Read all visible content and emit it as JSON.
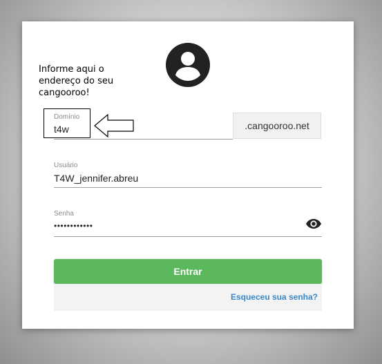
{
  "annotation": {
    "line1": "Informe aqui o",
    "line2": "endereço do seu",
    "line3": "cangooroo!"
  },
  "login": {
    "avatar_icon": "account-circle-icon",
    "domain": {
      "label": "Domínio",
      "value": "t4w",
      "suffix": ".cangooroo.net"
    },
    "user": {
      "label": "Usuário",
      "value": "T4W_jennifer.abreu"
    },
    "password": {
      "label": "Senha",
      "value": "••••••••••••",
      "toggle_icon": "eye-icon"
    },
    "submit_label": "Entrar",
    "forgot_label": "Esqueceu sua senha?"
  },
  "colors": {
    "button": "#5cb85c",
    "link": "#3a87c8"
  }
}
